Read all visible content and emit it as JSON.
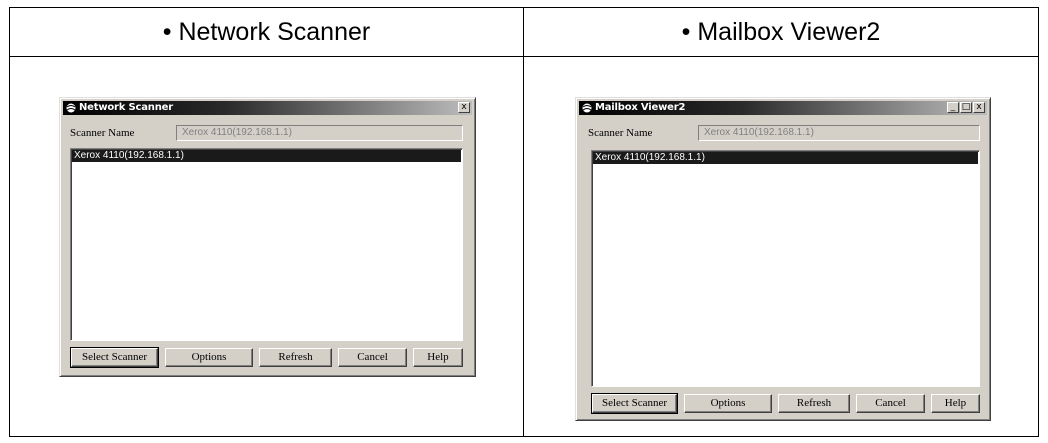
{
  "headings": {
    "left": "• Network Scanner",
    "right": "• Mailbox Viewer2"
  },
  "windows": [
    {
      "title": "Network Scanner",
      "scanner_name_label": "Scanner Name",
      "scanner_name_value": "Xerox 4110(192.168.1.1)",
      "list_items": [
        "Xerox 4110(192.168.1.1)"
      ],
      "buttons": [
        "Select Scanner",
        "Options",
        "Refresh",
        "Cancel",
        "Help"
      ],
      "close_glyph": "x"
    },
    {
      "title": "Mailbox Viewer2",
      "scanner_name_label": "Scanner Name",
      "scanner_name_value": "Xerox 4110(192.168.1.1)",
      "list_items": [
        "Xerox 4110(192.168.1.1)"
      ],
      "buttons": [
        "Select Scanner",
        "Options",
        "Refresh",
        "Cancel",
        "Help"
      ],
      "min_glyph": "_",
      "max_glyph": "□",
      "close_glyph": "x"
    }
  ],
  "colors": {
    "window_bg": "#d4d0c8",
    "titlebar_start": "#000000",
    "titlebar_end": "#bdbdbd",
    "selection_bg": "#1a1a1a"
  },
  "icons": {
    "window_icon": "scanner-globe-icon"
  }
}
